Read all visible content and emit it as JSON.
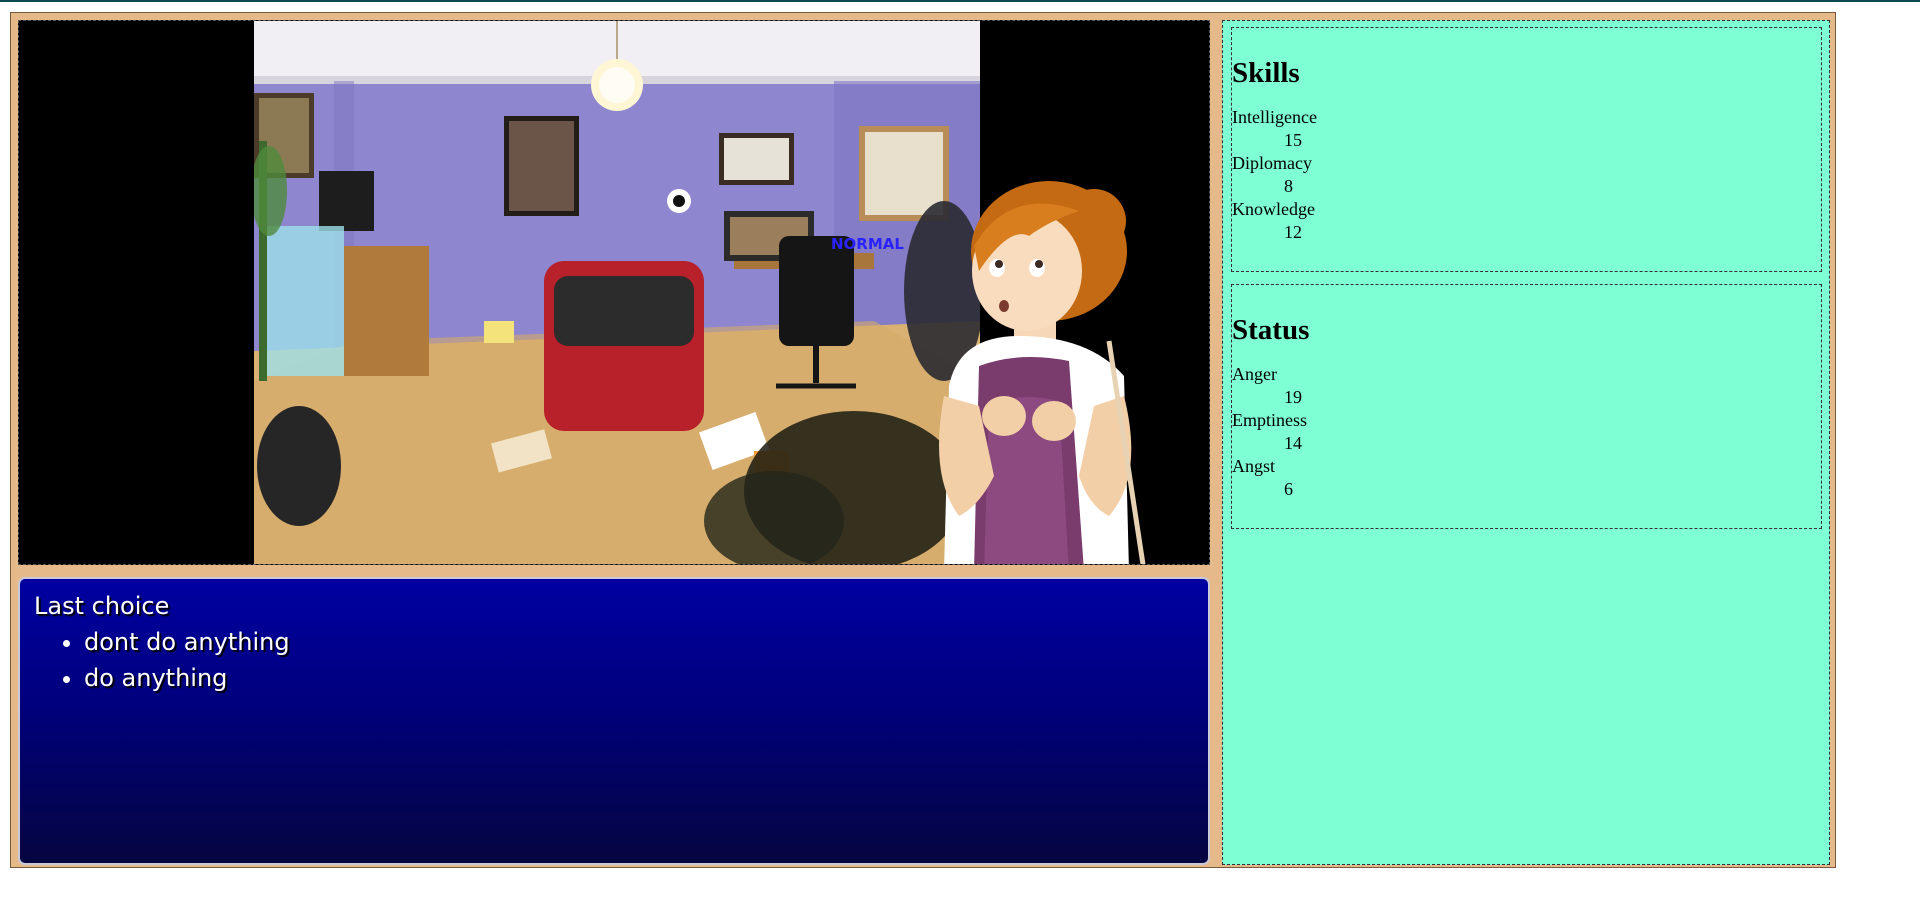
{
  "scene": {
    "mood_label": "NORMAL",
    "background": "messy-bedroom-illustration",
    "character": "girl-looking-up-illustration"
  },
  "dialogue": {
    "heading": "Last choice",
    "choices": [
      {
        "label": "dont do anything"
      },
      {
        "label": "do anything"
      }
    ]
  },
  "sidebar": {
    "skills": {
      "title": "Skills",
      "items": [
        {
          "name": "Intelligence",
          "value": "15"
        },
        {
          "name": "Diplomacy",
          "value": "8"
        },
        {
          "name": "Knowledge",
          "value": "12"
        }
      ]
    },
    "status": {
      "title": "Status",
      "items": [
        {
          "name": "Anger",
          "value": "19"
        },
        {
          "name": "Emptiness",
          "value": "14"
        },
        {
          "name": "Angst",
          "value": "6"
        }
      ]
    }
  },
  "colors": {
    "frame": "#e6b98b",
    "sidebar": "#7fffd4",
    "dialogue_top": "#0000a2",
    "dialogue_bottom": "#050540",
    "mood_label": "#2a22ff"
  }
}
